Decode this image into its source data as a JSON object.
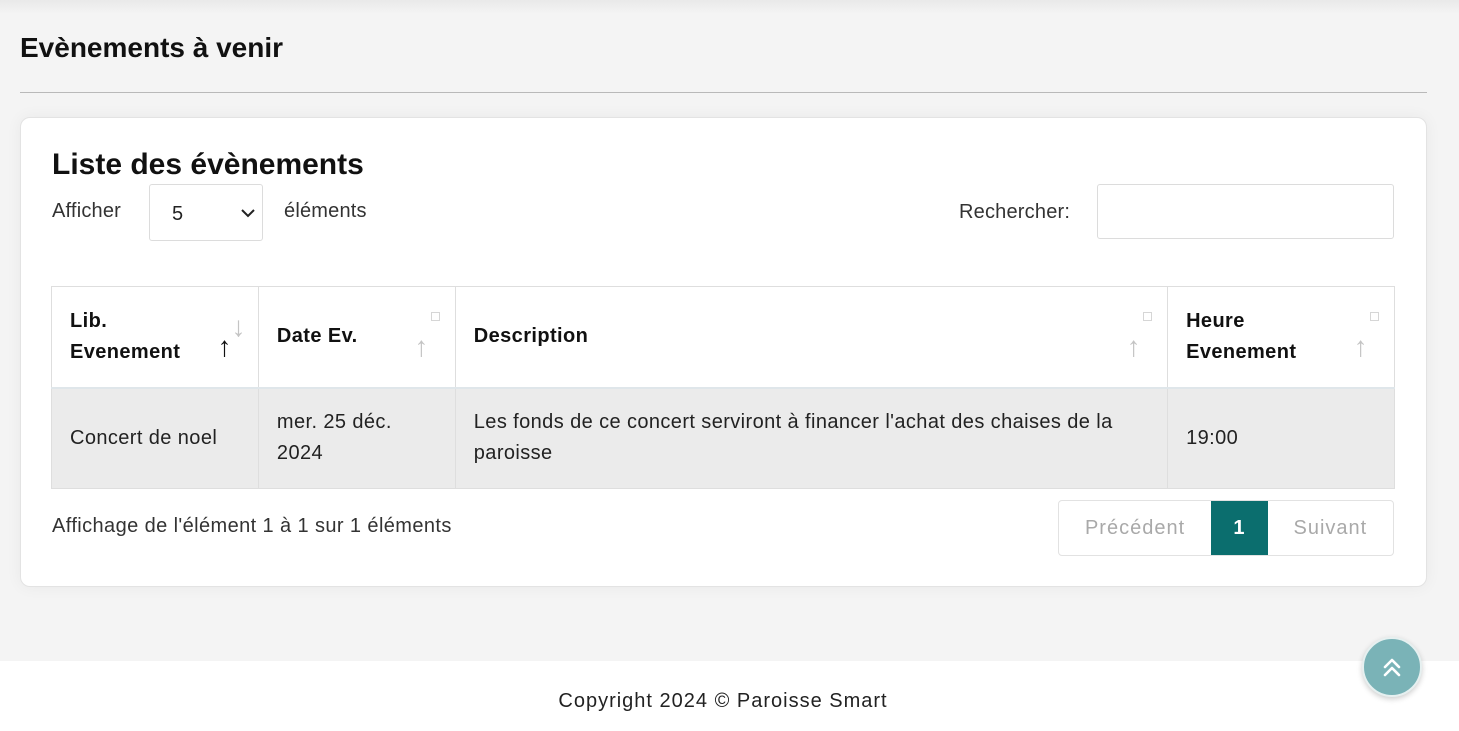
{
  "page": {
    "title": "Evènements à venir"
  },
  "card": {
    "title": "Liste des évènements",
    "length_label": "Afficher",
    "length_value": "5",
    "length_suffix": "éléments",
    "search_label": "Rechercher:",
    "search_value": ""
  },
  "table": {
    "columns": [
      "Lib.\nEvenement",
      "Date Ev.",
      "Description",
      "Heure\nEvenement"
    ],
    "sort": {
      "column": 0,
      "direction": "ascending"
    },
    "rows": [
      [
        "Concert de noel",
        "mer. 25 déc.\n2024",
        "Les fonds de ce concert serviront à financer l'achat des chaises de la paroisse",
        "19:00"
      ]
    ]
  },
  "info": "Affichage de l'élément 1 à 1 sur 1 éléments",
  "pagination": {
    "previous": "Précédent",
    "current": "1",
    "next": "Suivant"
  },
  "footer": {
    "copyright": "Copyright 2024 © Paroisse Smart"
  },
  "icons": {
    "select": "chevron-down-icon",
    "sort": "sort-arrows-icon",
    "back_to_top": "double-chevron-up-icon"
  },
  "colors": {
    "accent": "#0b6e6e",
    "back_to_top": "#7ab3b7"
  }
}
